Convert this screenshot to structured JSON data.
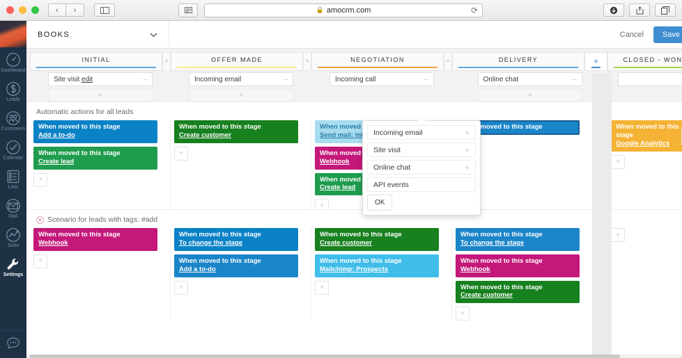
{
  "browser": {
    "url": "amocrm.com",
    "lock_icon": "lock-icon",
    "back_label": "‹",
    "forward_label": "›",
    "sidebar_toggle_icon": "sidebar-toggle-icon",
    "reader_icon": "reader-view-icon",
    "reload_icon": "⟳",
    "download_icon": "download-icon",
    "share_icon": "share-icon",
    "tabs_icon": "tabs-icon"
  },
  "sidebar": {
    "avatar": "user-avatar",
    "items": [
      {
        "label": "Dashboard",
        "icon": "dashboard-icon",
        "active": false
      },
      {
        "label": "Leads",
        "icon": "leads-icon",
        "active": false
      },
      {
        "label": "Customers",
        "icon": "customers-icon",
        "active": false
      },
      {
        "label": "Calendar",
        "icon": "calendar-icon",
        "active": false
      },
      {
        "label": "Lists",
        "icon": "lists-icon",
        "active": false
      },
      {
        "label": "Mail",
        "icon": "mail-icon",
        "active": false
      },
      {
        "label": "Stats",
        "icon": "stats-icon",
        "active": false
      },
      {
        "label": "Settings",
        "icon": "settings-icon",
        "active": true
      }
    ],
    "chat_icon": "chat-bot-icon"
  },
  "topbar": {
    "pipeline_name": "BOOKS",
    "chevron": "chevron-down-icon",
    "cancel_label": "Cancel",
    "save_label": "Save",
    "save_color": "#3e8ed0"
  },
  "stages": [
    {
      "name": "INITIAL",
      "color": "#57a8e8"
    },
    {
      "name": "OFFER MADE",
      "color": "#f5f08a"
    },
    {
      "name": "NEGOTIATION",
      "color": "#f5a13c"
    },
    {
      "name": "DELIVERY",
      "color": "#57a8e8"
    },
    {
      "name": "CLOSED - WON",
      "color": "#9fdb54"
    }
  ],
  "add_stage_label": "+",
  "add_column": {
    "plus": "+",
    "color": "#3e8ed0"
  },
  "triggers": [
    {
      "value": "Site visit",
      "suffix": "edit",
      "caret": "chevron-down-icon",
      "add_label": "+"
    },
    {
      "value": "Incoming email",
      "suffix": "",
      "caret": "chevron-down-icon",
      "add_label": "+"
    },
    {
      "value": "Incoming call",
      "suffix": "",
      "caret": "chevron-down-icon",
      "add_label": ""
    },
    {
      "value": "Online chat",
      "suffix": "",
      "caret": "chevron-down-icon",
      "add_label": "+"
    },
    {
      "value": "",
      "suffix": "",
      "caret": "",
      "add_label": ""
    }
  ],
  "popup": {
    "items": [
      {
        "label": "Incoming email",
        "plus": "+"
      },
      {
        "label": "Site visit",
        "plus": "+"
      },
      {
        "label": "Online chat",
        "plus": "+"
      },
      {
        "label": "API events",
        "plus": ""
      }
    ],
    "ok_label": "OK"
  },
  "sections": [
    {
      "title": "Automatic actions for all leads",
      "has_close_icon": false,
      "columns": [
        {
          "stage": "INITIAL",
          "add_label": "+",
          "cards": [
            {
              "line1": "When moved to this stage",
              "line2": "Add a to-do",
              "color": "#0b82c6",
              "selected": false
            },
            {
              "line1": "When moved to this stage",
              "line2": "Create lead",
              "color": "#1f9c4d",
              "selected": false
            }
          ]
        },
        {
          "stage": "OFFER MADE",
          "add_label": "+",
          "cards": [
            {
              "line1": "When moved to this stage",
              "line2": "Create customer",
              "color": "#17801f",
              "selected": false
            }
          ]
        },
        {
          "stage": "NEGOTIATION",
          "add_label": "+",
          "cards": [
            {
              "line1": "When moved to this stage",
              "line2": "Send mail: Introduction",
              "color": "#a8dcf0",
              "selected": false
            },
            {
              "line1": "When moved to this stage",
              "line2": "Webhook",
              "color": "#c4187a",
              "selected": false
            },
            {
              "line1": "When moved to this stage",
              "line2": "Create lead",
              "color": "#1f9c4d",
              "selected": false
            }
          ]
        },
        {
          "stage": "DELIVERY",
          "add_label": "",
          "cards": [
            {
              "line1": "When moved to this stage",
              "line2": "",
              "color": "#1b85c9",
              "selected": true
            }
          ]
        },
        {
          "stage": "CLOSED - WON",
          "add_label": "+",
          "cards": [
            {
              "line1": "When moved to this stage",
              "line2": "Google Analytics",
              "color": "#f5b335",
              "selected": false
            }
          ]
        }
      ]
    },
    {
      "title": "Scenario for leads with tags: #add",
      "has_close_icon": true,
      "close_icon": "remove-scenario-icon",
      "columns": [
        {
          "stage": "INITIAL",
          "add_label": "+",
          "cards": [
            {
              "line1": "When moved to this stage",
              "line2": "Webhook",
              "color": "#c4187a",
              "selected": false
            }
          ]
        },
        {
          "stage": "OFFER MADE",
          "add_label": "+",
          "cards": [
            {
              "line1": "When moved to this stage",
              "line2": "To change the stage",
              "color": "#0b82c6",
              "selected": false
            },
            {
              "line1": "When moved to this stage",
              "line2": "Add a to-do",
              "color": "#1b85c9",
              "selected": false
            }
          ]
        },
        {
          "stage": "NEGOTIATION",
          "add_label": "+",
          "cards": [
            {
              "line1": "When moved to this stage",
              "line2": "Create customer",
              "color": "#17801f",
              "selected": false
            },
            {
              "line1": "When moved to this stage",
              "line2": "Mailchimp: Prospects",
              "color": "#40bde8",
              "selected": false
            }
          ]
        },
        {
          "stage": "DELIVERY",
          "add_label": "+",
          "cards": [
            {
              "line1": "When moved to this stage",
              "line2": "To change the stage",
              "color": "#1b85c9",
              "selected": false
            },
            {
              "line1": "When moved to this stage",
              "line2": "Webhook",
              "color": "#c4187a",
              "selected": false
            },
            {
              "line1": "When moved to this stage",
              "line2": "Create customer",
              "color": "#17801f",
              "selected": false
            }
          ]
        },
        {
          "stage": "CLOSED - WON",
          "add_label": "+",
          "cards": []
        }
      ]
    }
  ]
}
